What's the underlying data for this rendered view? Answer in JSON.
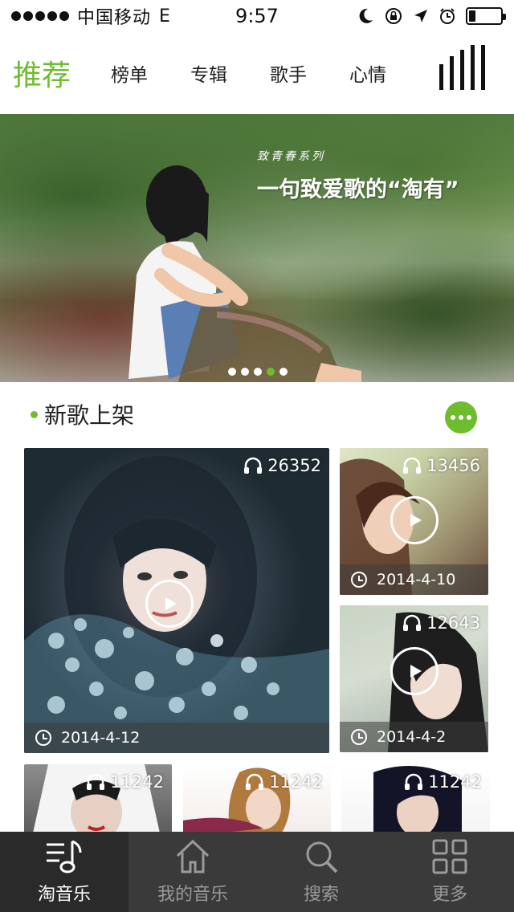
{
  "status_bar": {
    "carrier": "中国移动",
    "network": "E",
    "time": "9:57",
    "battery_level": 0.2
  },
  "top_nav": {
    "tabs": [
      {
        "label": "推荐",
        "active": true
      },
      {
        "label": "榜单",
        "active": false
      },
      {
        "label": "专辑",
        "active": false
      },
      {
        "label": "歌手",
        "active": false
      },
      {
        "label": "心情",
        "active": false
      }
    ],
    "menu_icon": "equalizer-bars-icon"
  },
  "banner": {
    "kicker": "致青春系列",
    "title": "一句致爱歌的“淘有”",
    "slide_count": 5,
    "active_slide": 4
  },
  "new_songs": {
    "title": "新歌上架",
    "more_icon": "more-dots-icon",
    "accent": "#6ebd2e",
    "albums": [
      {
        "plays": "26352",
        "date": "2014-4-12"
      },
      {
        "plays": "13456",
        "date": "2014-4-10"
      },
      {
        "plays": "12643",
        "date": "2014-4-2"
      },
      {
        "plays": "11242"
      },
      {
        "plays": "11242"
      },
      {
        "plays": "11242"
      }
    ]
  },
  "tab_bar": {
    "tabs": [
      {
        "label": "淘音乐",
        "icon": "music-note-icon",
        "active": true
      },
      {
        "label": "我的音乐",
        "icon": "home-icon",
        "active": false
      },
      {
        "label": "搜索",
        "icon": "search-icon",
        "active": false
      },
      {
        "label": "更多",
        "icon": "grid-icon",
        "active": false
      }
    ]
  }
}
